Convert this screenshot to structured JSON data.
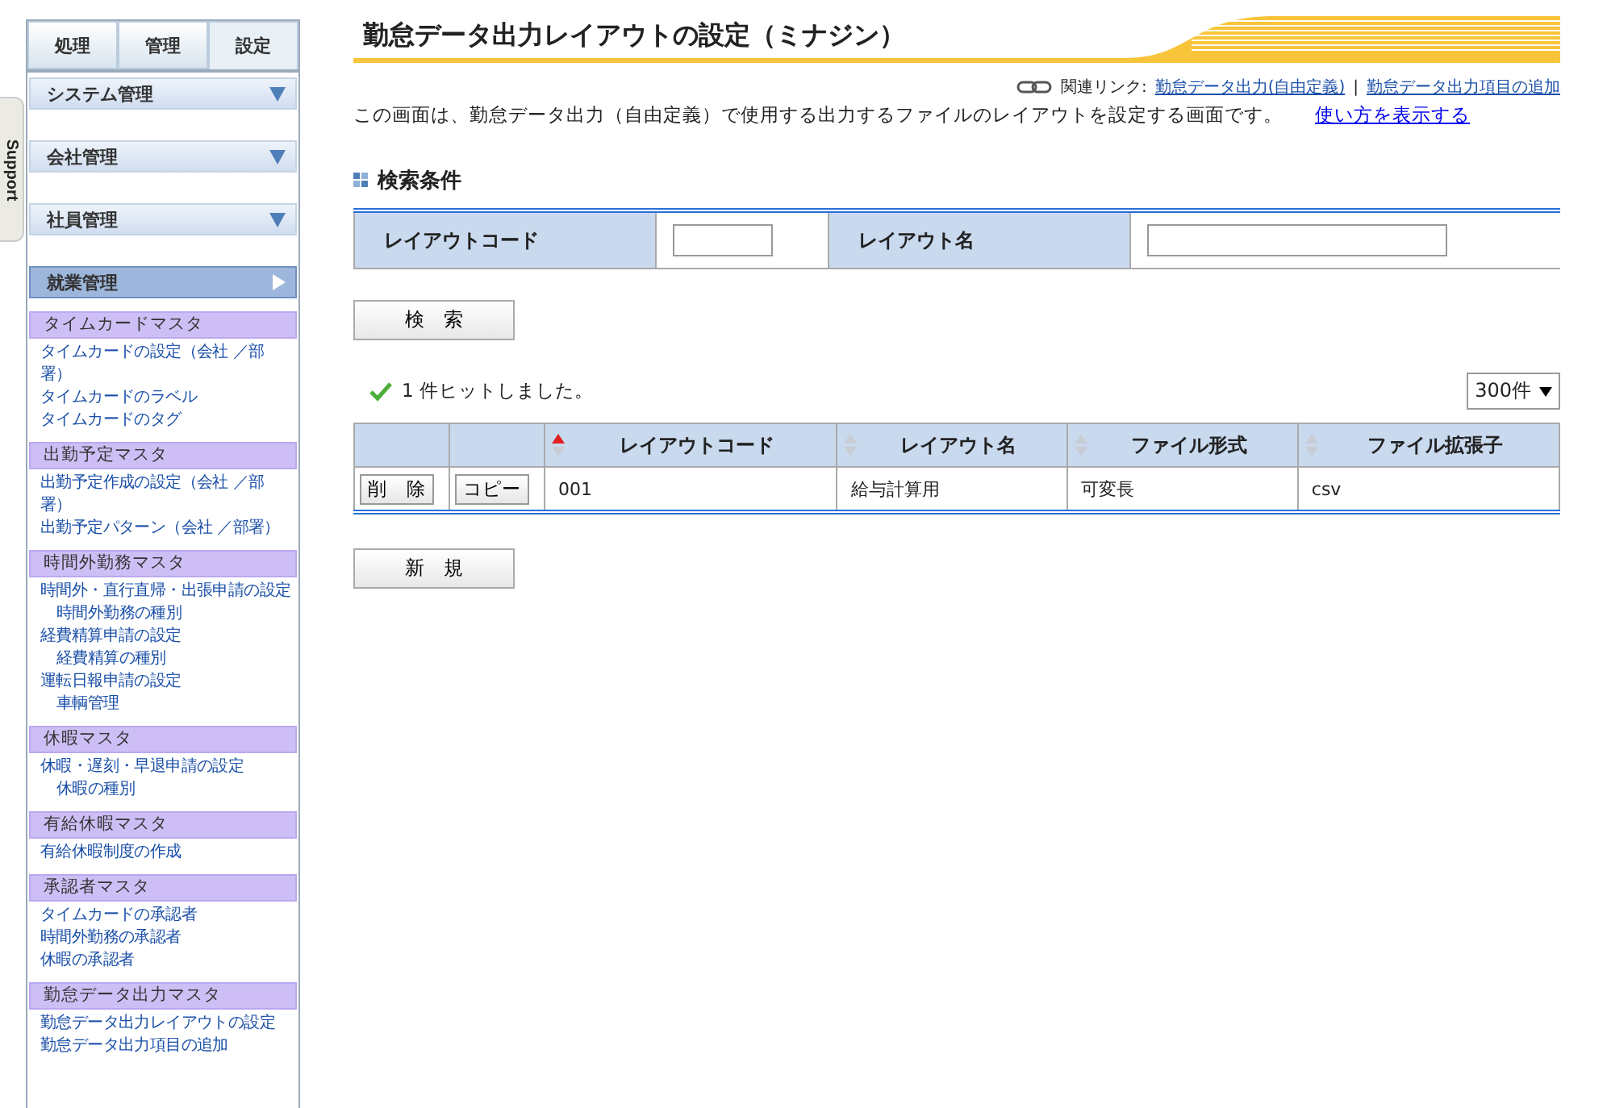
{
  "support_tab": {
    "label": "Support"
  },
  "sidebar": {
    "tabs": [
      {
        "label": "処理",
        "selected": false
      },
      {
        "label": "管理",
        "selected": false
      },
      {
        "label": "設定",
        "selected": true
      }
    ],
    "sections": [
      {
        "label": "システム管理",
        "expanded": false
      },
      {
        "label": "会社管理",
        "expanded": false
      },
      {
        "label": "社員管理",
        "expanded": false
      },
      {
        "label": "就業管理",
        "expanded": true,
        "groups": [
          {
            "title": "タイムカードマスタ",
            "items": [
              {
                "label": "タイムカードの設定（会社 ／部署）"
              },
              {
                "label": "タイムカードのラベル"
              },
              {
                "label": "タイムカードのタグ"
              }
            ]
          },
          {
            "title": "出勤予定マスタ",
            "items": [
              {
                "label": "出勤予定作成の設定（会社 ／部署）"
              },
              {
                "label": "出勤予定パターン（会社 ／部署）"
              }
            ]
          },
          {
            "title": "時間外勤務マスタ",
            "items": [
              {
                "label": "時間外・直行直帰・出張申請の設定",
                "children": [
                  {
                    "label": "時間外勤務の種別"
                  }
                ]
              },
              {
                "label": "経費精算申請の設定",
                "children": [
                  {
                    "label": "経費精算の種別"
                  }
                ]
              },
              {
                "label": "運転日報申請の設定",
                "children": [
                  {
                    "label": "車輌管理"
                  }
                ]
              }
            ]
          },
          {
            "title": "休暇マスタ",
            "items": [
              {
                "label": "休暇・遅刻・早退申請の設定",
                "children": [
                  {
                    "label": "休暇の種別"
                  }
                ]
              }
            ]
          },
          {
            "title": "有給休暇マスタ",
            "items": [
              {
                "label": "有給休暇制度の作成"
              }
            ]
          },
          {
            "title": "承認者マスタ",
            "items": [
              {
                "label": "タイムカードの承認者"
              },
              {
                "label": "時間外勤務の承認者"
              },
              {
                "label": "休暇の承認者"
              }
            ]
          },
          {
            "title": "勤怠データ出力マスタ",
            "items": [
              {
                "label": "勤怠データ出力レイアウトの設定"
              },
              {
                "label": "勤怠データ出力項目の追加"
              }
            ]
          }
        ]
      }
    ]
  },
  "page": {
    "title": "勤怠データ出力レイアウトの設定（ミナジン）",
    "related_label": "関連リンク:",
    "related_links": [
      "勤怠データ出力(自由定義)",
      "勤怠データ出力項目の追加"
    ],
    "related_separator": "|",
    "description": "この画面は、勤怠データ出力（自由定義）で使用する出力するファイルのレイアウトを設定する画面です。",
    "help_link": "使い方を表示する"
  },
  "search": {
    "heading": "検索条件",
    "fields": [
      {
        "label": "レイアウトコード"
      },
      {
        "label": "レイアウト名"
      }
    ],
    "button": "検　索"
  },
  "results": {
    "message": "1 件ヒットしました。",
    "page_size": "300件",
    "columns": [
      {
        "label": "レイアウトコード",
        "sorted": true
      },
      {
        "label": "レイアウト名",
        "sorted": false
      },
      {
        "label": "ファイル形式",
        "sorted": false
      },
      {
        "label": "ファイル拡張子",
        "sorted": false
      }
    ],
    "rows": [
      {
        "delete": "削　除",
        "copy": "コピー",
        "cells": [
          "001",
          "給与計算用",
          "可変長",
          "csv"
        ]
      }
    ]
  },
  "new_button": "新　規"
}
